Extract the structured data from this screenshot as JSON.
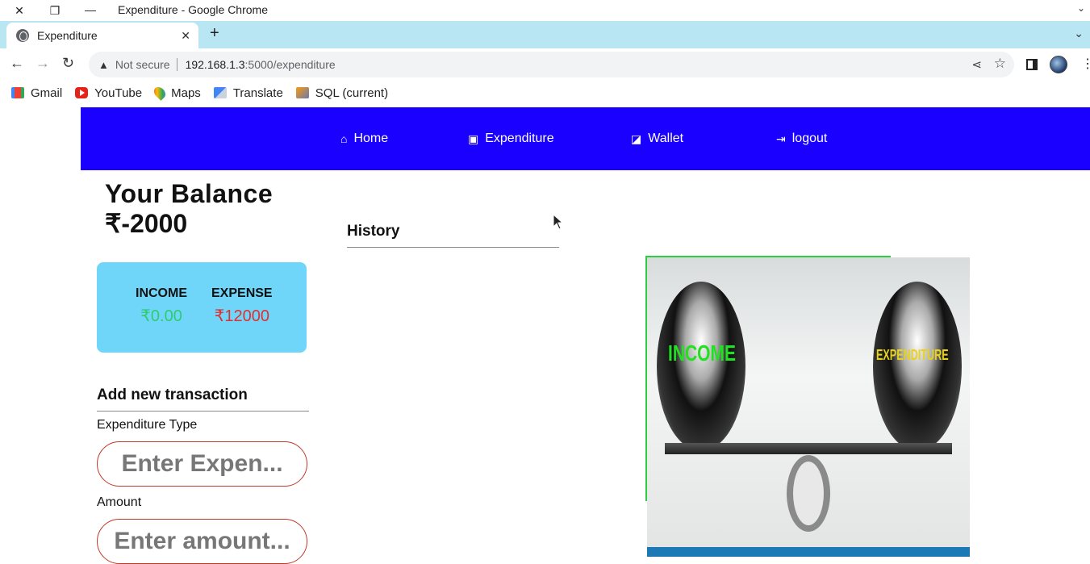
{
  "window": {
    "title": "Expenditure - Google Chrome"
  },
  "tab": {
    "title": "Expenditure"
  },
  "address": {
    "security": "Not secure",
    "host": "192.168.1.3",
    "path": ":5000/expenditure"
  },
  "bookmarks": [
    "Gmail",
    "YouTube",
    "Maps",
    "Translate",
    "SQL (current)"
  ],
  "nav": {
    "home": "Home",
    "expenditure": "Expenditure",
    "wallet": "Wallet",
    "logout": "logout"
  },
  "balance": {
    "title": "Your Balance",
    "value": "₹-2000"
  },
  "summary": {
    "income_label": "INCOME",
    "income_value": "₹0.00",
    "expense_label": "EXPENSE",
    "expense_value": "₹12000"
  },
  "history": {
    "title": "History"
  },
  "form": {
    "title": "Add new transaction",
    "type_label": "Expenditure Type",
    "type_placeholder": "Enter Expen...",
    "amount_label": "Amount",
    "amount_placeholder": "Enter amount..."
  },
  "image": {
    "left_text": "INCOME",
    "right_text": "EXPENDITURE"
  },
  "colors": {
    "navbar": "#1a00ff",
    "card": "#6fd6fa",
    "income": "#2ecc71",
    "expense": "#e03030",
    "input_border": "#c0392b"
  }
}
